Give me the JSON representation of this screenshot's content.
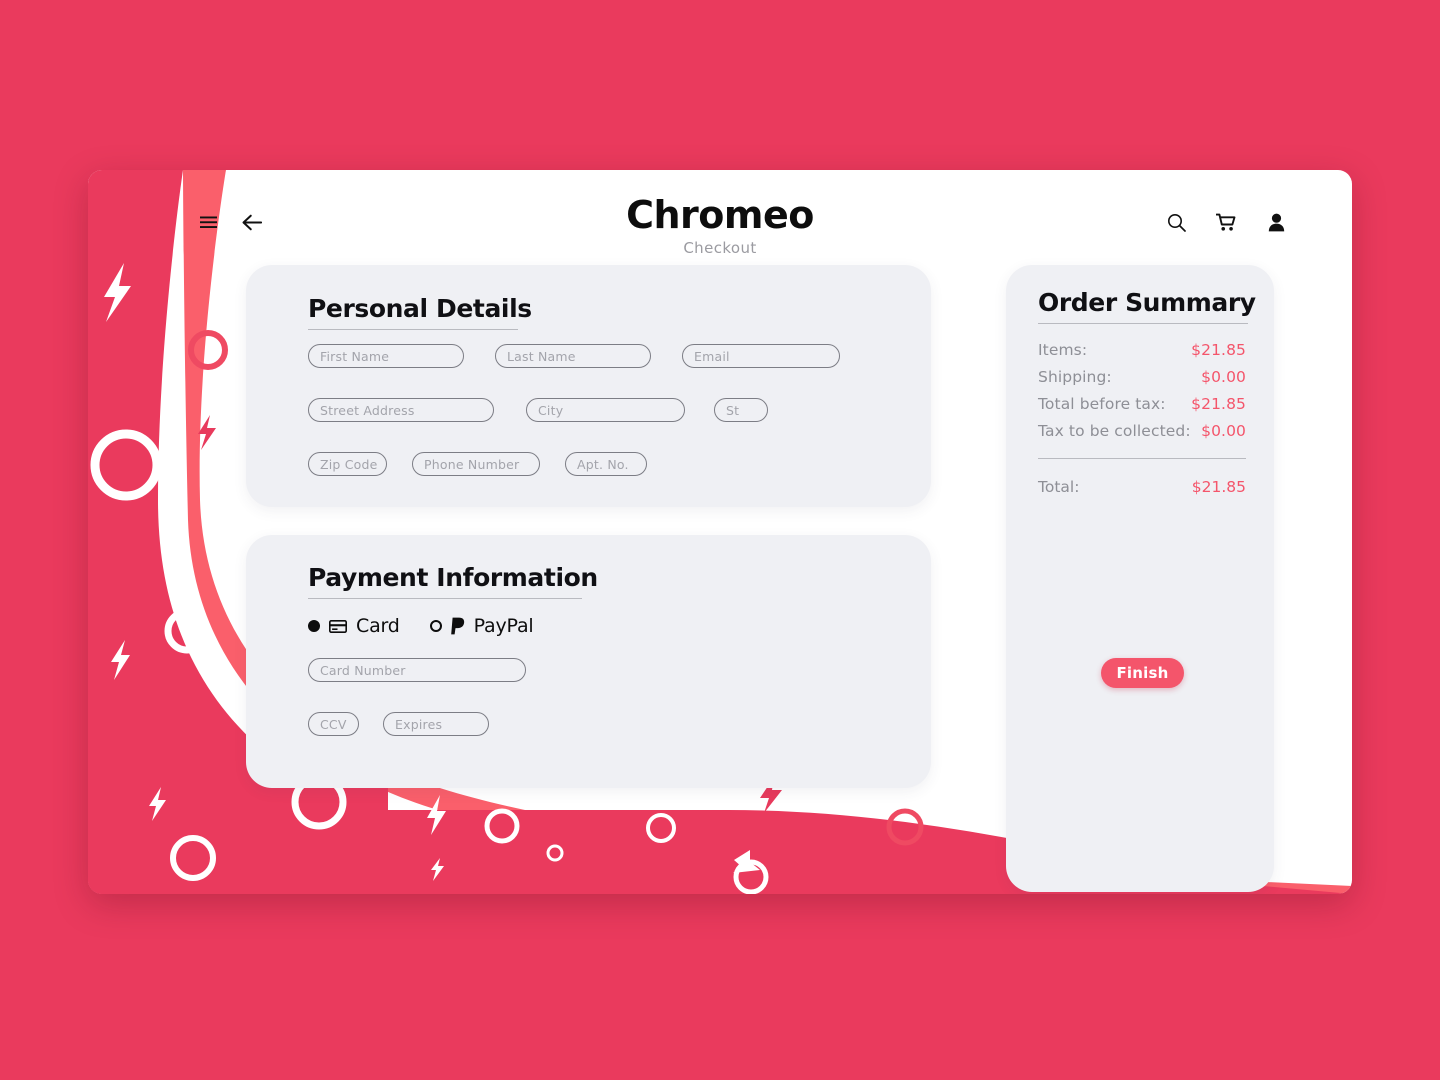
{
  "theme": {
    "page_background": "#ea3a5d",
    "band_light": "#fa5f6b",
    "panel_background": "#eff0f4",
    "accent": "#f4556b",
    "text_dark": "#0d0d0d",
    "text_muted": "#8e8f96",
    "placeholder": "#a3a4ab"
  },
  "header": {
    "menu_icon": "hamburger-menu-icon",
    "back_icon": "back-arrow-icon",
    "brand": "Chromeo",
    "subtitle": "Checkout",
    "search_icon": "search-icon",
    "cart_icon": "shopping-cart-icon",
    "account_icon": "user-account-icon"
  },
  "personal_details": {
    "heading": "Personal Details",
    "fields": [
      {
        "name": "first-name",
        "placeholder": "First Name",
        "value": ""
      },
      {
        "name": "last-name",
        "placeholder": "Last Name",
        "value": ""
      },
      {
        "name": "email",
        "placeholder": "Email",
        "value": ""
      },
      {
        "name": "street-address",
        "placeholder": "Street Address",
        "value": ""
      },
      {
        "name": "city",
        "placeholder": "City",
        "value": ""
      },
      {
        "name": "state",
        "placeholder": "St",
        "value": ""
      },
      {
        "name": "zip-code",
        "placeholder": "Zip Code",
        "value": ""
      },
      {
        "name": "phone-number",
        "placeholder": "Phone Number",
        "value": ""
      },
      {
        "name": "apartment-number",
        "placeholder": "Apt. No.",
        "value": ""
      }
    ]
  },
  "payment_information": {
    "heading": "Payment Information",
    "methods": [
      {
        "id": "card",
        "label": "Card",
        "selected": true,
        "icon": "credit-card-icon"
      },
      {
        "id": "paypal",
        "label": "PayPal",
        "selected": false,
        "icon": "paypal-icon"
      }
    ],
    "fields": [
      {
        "name": "card-number",
        "placeholder": "Card Number",
        "value": ""
      },
      {
        "name": "ccv",
        "placeholder": "CCV",
        "value": ""
      },
      {
        "name": "expires",
        "placeholder": "Expires",
        "value": ""
      }
    ]
  },
  "order_summary": {
    "heading": "Order Summary",
    "lines": [
      {
        "label": "Items:",
        "amount": "$21.85"
      },
      {
        "label": "Shipping:",
        "amount": "$0.00"
      },
      {
        "label": "Total before tax:",
        "amount": "$21.85"
      },
      {
        "label": "Tax to be collected:",
        "amount": "$0.00"
      }
    ],
    "total": {
      "label": "Total:",
      "amount": "$21.85"
    },
    "finish_label": "Finish"
  }
}
